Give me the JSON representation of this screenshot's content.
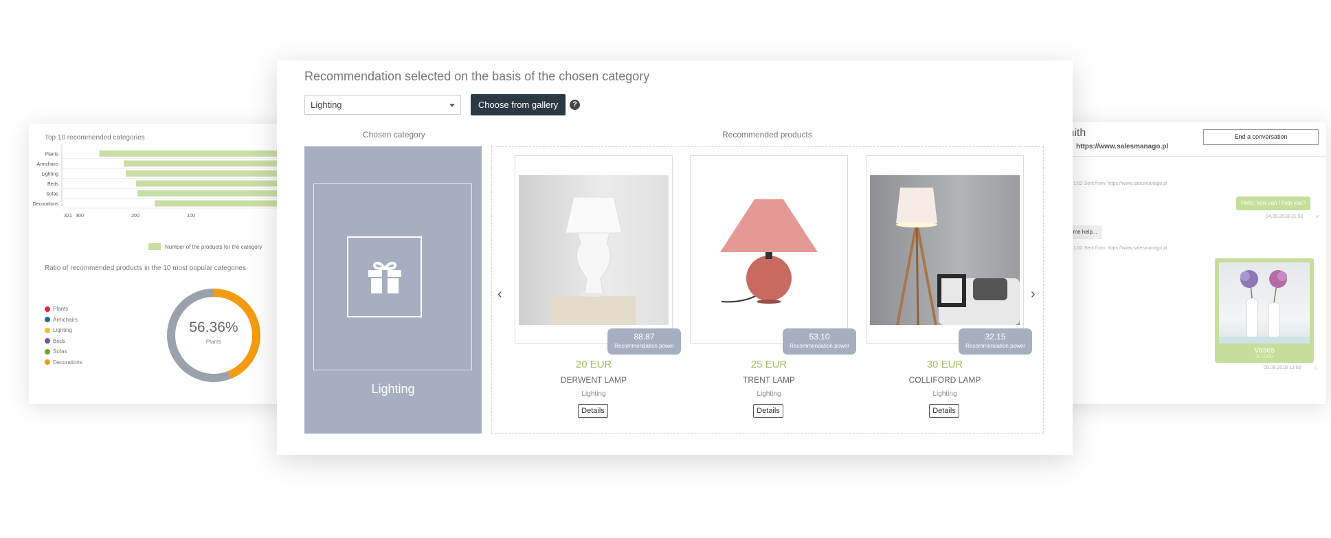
{
  "left_card": {
    "bar_title": "Top 10 recommended categories",
    "bar_legend": "Number of the products for the category",
    "pie_title": "Ratio of recommended products in the 10 most popular categories",
    "donut_percent": "56.36%",
    "donut_label": "Plants"
  },
  "chart_data": [
    {
      "type": "bar",
      "orientation": "horizontal",
      "title": "Top 10 recommended categories",
      "categories": [
        "Plants",
        "Armchairs",
        "Lighting",
        "Beds",
        "Sofas",
        "Decorations"
      ],
      "values": [
        265,
        221,
        217,
        199,
        196,
        165
      ],
      "x_ticks": [
        "321",
        "300",
        "200",
        "100"
      ],
      "legend": [
        "Number of the products for the category"
      ],
      "colors": [
        "#c8dea4"
      ]
    },
    {
      "type": "pie",
      "title": "Ratio of recommended products in the 10 most popular categories",
      "labels": [
        "Plants",
        "Armchairs",
        "Lighting",
        "Beds",
        "Sofas",
        "Decorations"
      ],
      "colors": [
        "#e5224a",
        "#1f6ba0",
        "#f4c12b",
        "#7b4ea0",
        "#6ea62a",
        "#f39c12"
      ],
      "center_label": "56.36%",
      "center_sublabel": "Plants",
      "visible_arcs": [
        {
          "color": "#f39c12",
          "fraction": 0.44
        },
        {
          "color": "#9aa2ac",
          "fraction": 0.56
        }
      ]
    }
  ],
  "right_card": {
    "contact_name": "mith",
    "contact_site": "https://www.salesmanago.pl",
    "end_button": "End a conversation",
    "msg1_meta": "1:02 Sent from: https://www.salesmanago.pl",
    "msg1_text": "Hello, how can I help you?",
    "msg1_time": "04.09.2018 21:02",
    "msg2_text": "ome help...",
    "msg2_meta": "1:02 Sent from: https://www.salesmanago.pl",
    "product_name": "Vases",
    "product_price": "25 EURO",
    "product_time": "05.09.2018 12:02"
  },
  "main": {
    "title": "Recommendation selected on the basis of the chosen category",
    "select_value": "Lighting",
    "gallery_button": "Choose from gallery",
    "help_icon": "?",
    "chosen_head": "Chosen category",
    "reco_head": "Recommended products",
    "category_label": "Lighting",
    "prev_arrow": "‹",
    "next_arrow": "›",
    "products": [
      {
        "price": "20 EUR",
        "name": "DERWENT LAMP",
        "category": "Lighting",
        "power": "88.87",
        "power_label": "Recommendation power",
        "details": "Details"
      },
      {
        "price": "25 EUR",
        "name": "TRENT LAMP",
        "category": "Lighting",
        "power": "53.10",
        "power_label": "Recommendation power",
        "details": "Details"
      },
      {
        "price": "30 EUR",
        "name": "COLLIFORD LAMP",
        "category": "Lighting",
        "power": "32.15",
        "power_label": "Recommendation power",
        "details": "Details"
      }
    ]
  }
}
